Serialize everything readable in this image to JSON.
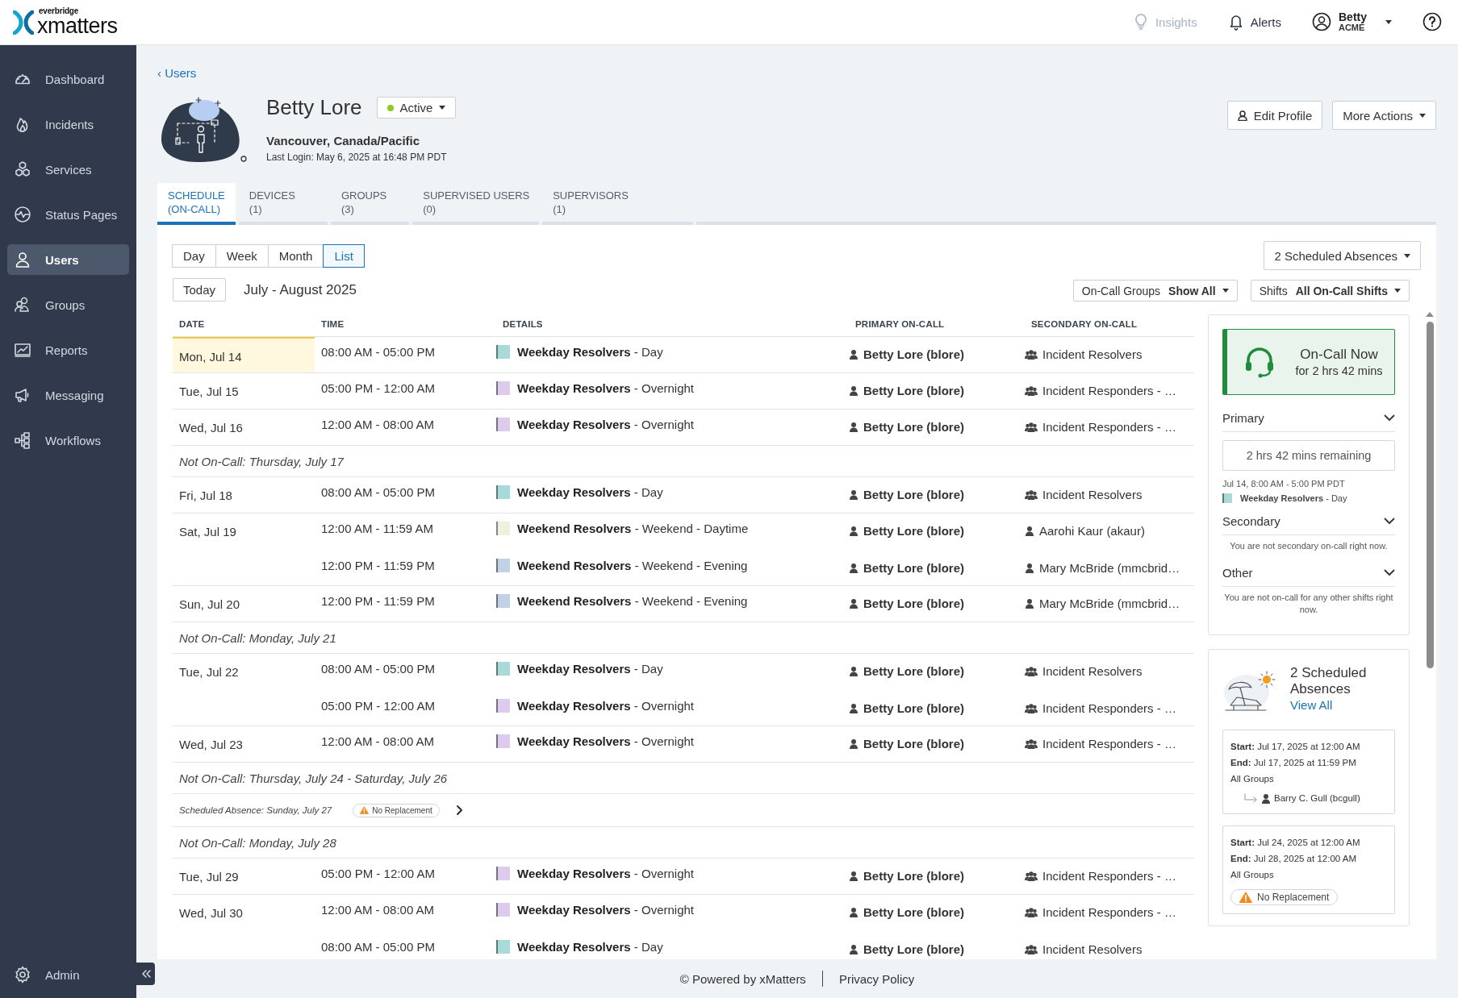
{
  "header": {
    "logo": {
      "tagline": "everbridge",
      "brand": "xmatters"
    },
    "nav": [
      {
        "label": "Insights",
        "disabled": true
      },
      {
        "label": "Alerts",
        "disabled": false
      }
    ],
    "user": {
      "name": "Betty",
      "org": "ACME"
    }
  },
  "sidebar": {
    "items": [
      {
        "label": "Dashboard",
        "selected": false
      },
      {
        "label": "Incidents",
        "selected": false
      },
      {
        "label": "Services",
        "selected": false
      },
      {
        "label": "Status Pages",
        "selected": false
      },
      {
        "label": "Users",
        "selected": true
      },
      {
        "label": "Groups",
        "selected": false
      },
      {
        "label": "Reports",
        "selected": false
      },
      {
        "label": "Messaging",
        "selected": false
      },
      {
        "label": "Workflows",
        "selected": false
      }
    ],
    "footer_item": {
      "label": "Admin"
    }
  },
  "breadcrumb": "‹ Users",
  "profile": {
    "name": "Betty Lore",
    "status": "Active",
    "location": "Vancouver, Canada/Pacific",
    "last_login": "Last Login: May 6, 2025 at 16:48 PM PDT",
    "buttons": [
      "Edit Profile",
      "More Actions"
    ]
  },
  "tabs": [
    {
      "label": "SCHEDULE",
      "count": "(ON-CALL)",
      "selected": true
    },
    {
      "label": "DEVICES",
      "count": "(1)",
      "selected": false
    },
    {
      "label": "GROUPS",
      "count": "(3)",
      "selected": false
    },
    {
      "label": "SUPERVISED USERS",
      "count": "(0)",
      "selected": false
    },
    {
      "label": "SUPERVISORS",
      "count": "(1)",
      "selected": false
    }
  ],
  "views": [
    {
      "label": "Day",
      "selected": false
    },
    {
      "label": "Week",
      "selected": false
    },
    {
      "label": "Month",
      "selected": false
    },
    {
      "label": "List",
      "selected": true
    }
  ],
  "absences_dropdown": "2 Scheduled Absences",
  "today_button": "Today",
  "range": "July - August 2025",
  "filters": [
    {
      "label": "On-Call Groups",
      "value": "Show All"
    },
    {
      "label": "Shifts",
      "value": "All On-Call Shifts"
    }
  ],
  "table": {
    "columns": [
      "DATE",
      "TIME",
      "DETAILS",
      "PRIMARY ON-CALL",
      "SECONDARY ON-CALL"
    ],
    "rows": [
      {
        "kind": "day",
        "date": "Mon, Jul 14",
        "highlighted": true,
        "shifts": [
          {
            "time": "08:00 AM - 05:00 PM",
            "details": "**Weekday Resolvers** - Day",
            "color": "#a8dada",
            "primary": "Betty Lore (blore)",
            "secondary": {
              "kind": "group",
              "name": "Incident Resolvers"
            }
          }
        ]
      },
      {
        "kind": "day",
        "date": "Tue, Jul 15",
        "highlighted": false,
        "shifts": [
          {
            "time": "05:00 PM - 12:00 AM",
            "details": "**Weekday Resolvers** - Overnight",
            "color": "#dccbec",
            "primary": "Betty Lore (blore)",
            "secondary": {
              "kind": "group",
              "name": "Incident Responders - …"
            }
          }
        ]
      },
      {
        "kind": "day",
        "date": "Wed, Jul 16",
        "highlighted": false,
        "shifts": [
          {
            "time": "12:00 AM - 08:00 AM",
            "details": "**Weekday Resolvers** - Overnight",
            "color": "#dccbec",
            "primary": "Betty Lore (blore)",
            "secondary": {
              "kind": "group",
              "name": "Incident Responders - …"
            }
          }
        ]
      },
      {
        "kind": "gap",
        "text": "Not On-Call: Thursday, July 17"
      },
      {
        "kind": "day",
        "date": "Fri, Jul 18",
        "highlighted": false,
        "shifts": [
          {
            "time": "08:00 AM - 05:00 PM",
            "details": "**Weekday Resolvers** - Day",
            "color": "#a8dada",
            "primary": "Betty Lore (blore)",
            "secondary": {
              "kind": "group",
              "name": "Incident Resolvers"
            }
          }
        ]
      },
      {
        "kind": "day",
        "date": "Sat, Jul 19",
        "highlighted": false,
        "shifts": [
          {
            "time": "12:00 AM - 11:59 AM",
            "details": "**Weekend Resolvers** - Weekend - Daytime",
            "color": "#f0f0de",
            "primary": "Betty Lore (blore)",
            "secondary": {
              "kind": "person",
              "name": "Aarohi Kaur (akaur)"
            }
          },
          {
            "time": "12:00 PM - 11:59 PM",
            "details": "**Weekend Resolvers** - Weekend - Evening",
            "color": "#c2d2e6",
            "primary": "Betty Lore (blore)",
            "secondary": {
              "kind": "person",
              "name": "Mary McBride (mmcbrid…"
            }
          }
        ]
      },
      {
        "kind": "day",
        "date": "Sun, Jul 20",
        "highlighted": false,
        "shifts": [
          {
            "time": "12:00 PM - 11:59 PM",
            "details": "**Weekend Resolvers** - Weekend - Evening",
            "color": "#c2d2e6",
            "primary": "Betty Lore (blore)",
            "secondary": {
              "kind": "person",
              "name": "Mary McBride (mmcbrid…"
            }
          }
        ]
      },
      {
        "kind": "gap",
        "text": "Not On-Call: Monday, July 21"
      },
      {
        "kind": "day",
        "date": "Tue, Jul 22",
        "highlighted": false,
        "shifts": [
          {
            "time": "08:00 AM - 05:00 PM",
            "details": "**Weekday Resolvers** - Day",
            "color": "#a8dada",
            "primary": "Betty Lore (blore)",
            "secondary": {
              "kind": "group",
              "name": "Incident Resolvers"
            }
          },
          {
            "time": "05:00 PM - 12:00 AM",
            "details": "**Weekday Resolvers** - Overnight",
            "color": "#dccbec",
            "primary": "Betty Lore (blore)",
            "secondary": {
              "kind": "group",
              "name": "Incident Responders - …"
            }
          }
        ]
      },
      {
        "kind": "day",
        "date": "Wed, Jul 23",
        "highlighted": false,
        "shifts": [
          {
            "time": "12:00 AM - 08:00 AM",
            "details": "**Weekday Resolvers** - Overnight",
            "color": "#dccbec",
            "primary": "Betty Lore (blore)",
            "secondary": {
              "kind": "group",
              "name": "Incident Responders - …"
            }
          }
        ]
      },
      {
        "kind": "gap",
        "text": "Not On-Call: Thursday, July 24 - Saturday, July 26"
      },
      {
        "kind": "absence",
        "text": "Scheduled Absence: Sunday, July 27",
        "badge": "No Replacement"
      },
      {
        "kind": "gap",
        "text": "Not On-Call: Monday, July 28"
      },
      {
        "kind": "day",
        "date": "Tue, Jul 29",
        "highlighted": false,
        "shifts": [
          {
            "time": "05:00 PM - 12:00 AM",
            "details": "**Weekday Resolvers** - Overnight",
            "color": "#dccbec",
            "primary": "Betty Lore (blore)",
            "secondary": {
              "kind": "group",
              "name": "Incident Responders - …"
            }
          }
        ]
      },
      {
        "kind": "day",
        "date": "Wed, Jul 30",
        "highlighted": false,
        "shifts": [
          {
            "time": "12:00 AM - 08:00 AM",
            "details": "**Weekday Resolvers** - Overnight",
            "color": "#dccbec",
            "primary": "Betty Lore (blore)",
            "secondary": {
              "kind": "group",
              "name": "Incident Responders - …"
            }
          },
          {
            "time": "08:00 AM - 05:00 PM",
            "details": "**Weekday Resolvers** - Day",
            "color": "#a8dada",
            "primary": "Betty Lore (blore)",
            "secondary": {
              "kind": "group",
              "name": "Incident Resolvers"
            }
          }
        ]
      }
    ]
  },
  "on_call": {
    "title": "On-Call Now",
    "subtitle": "for 2 hrs 42 mins",
    "primary": {
      "title": "Primary",
      "remaining": "2 hrs 42 mins remaining",
      "time": "Jul 14, 8:00 AM - 5:00 PM PDT",
      "details": "**Weekday Resolvers** - Day",
      "color": "#a8dada"
    },
    "secondary": {
      "title": "Secondary",
      "message": "You are not secondary on-call right now."
    },
    "other": {
      "title": "Other",
      "message": "You are not on-call for any other shifts right now."
    }
  },
  "absences": {
    "title": "2 Scheduled Absences",
    "link": "View All",
    "items": [
      {
        "start": "**Start:** Jul 17, 2025 at 12:00 AM",
        "end": "**End:** Jul 17, 2025 at 11:59 PM",
        "groups": "All Groups",
        "replacement": "Barry C. Gull (bcgull)"
      },
      {
        "start": "**Start:** Jul 24, 2025 at 12:00 AM",
        "end": "**End:** Jul 28, 2025 at 12:00 AM",
        "groups": "All Groups",
        "badge": "No Replacement"
      }
    ]
  },
  "footer": {
    "copyright": "© Powered by xMatters",
    "link": "Privacy Policy"
  }
}
